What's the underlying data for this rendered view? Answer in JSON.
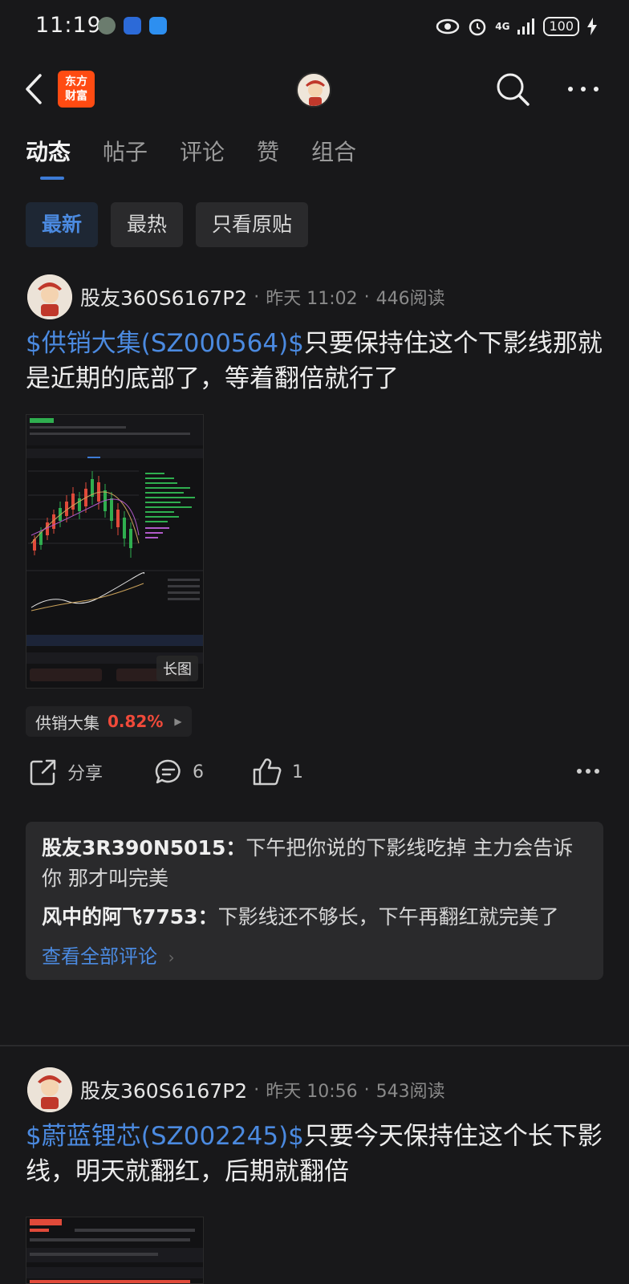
{
  "status_bar": {
    "time": "11:19",
    "network": "4G",
    "battery": "100"
  },
  "header": {
    "brand_logo_text": "东方\n财富",
    "icons": [
      "back-icon",
      "search-icon",
      "more-icon"
    ]
  },
  "tabs": [
    {
      "label": "动态",
      "active": true
    },
    {
      "label": "帖子",
      "active": false
    },
    {
      "label": "评论",
      "active": false
    },
    {
      "label": "赞",
      "active": false
    },
    {
      "label": "组合",
      "active": false
    }
  ],
  "filters": [
    {
      "label": "最新",
      "active": true
    },
    {
      "label": "最热",
      "active": false
    },
    {
      "label": "只看原贴",
      "active": false
    }
  ],
  "posts": [
    {
      "author": "股友360S6167P2",
      "time": "昨天 11:02",
      "reads": "446阅读",
      "stock_link": "$供销大集(SZ000564)$",
      "text": "只要保持住这个下影线那就是近期的底部了，等着翻倍就行了",
      "image_label": "长图",
      "stock_tag": {
        "name": "供销大集",
        "change": "0.82%"
      },
      "share_label": "分享",
      "comment_count": "6",
      "like_count": "1",
      "comments": [
        {
          "author": "股友3R390N5015：",
          "text": "下午把你说的下影线吃掉 主力会告诉你 那才叫完美"
        },
        {
          "author": "风中的阿飞7753：",
          "text": "下影线还不够长，下午再翻红就完美了"
        }
      ],
      "view_all": "查看全部评论"
    },
    {
      "author": "股友360S6167P2",
      "time": "昨天 10:56",
      "reads": "543阅读",
      "stock_link": "$蔚蓝锂芯(SZ002245)$",
      "text": "只要今天保持住这个长下影线，明天就翻红，后期就翻倍"
    }
  ],
  "colors": {
    "background": "#18181a",
    "accent_blue": "#4b8ae0",
    "price_up_red": "#f04a3a",
    "brand_orange": "#ff4b12"
  }
}
